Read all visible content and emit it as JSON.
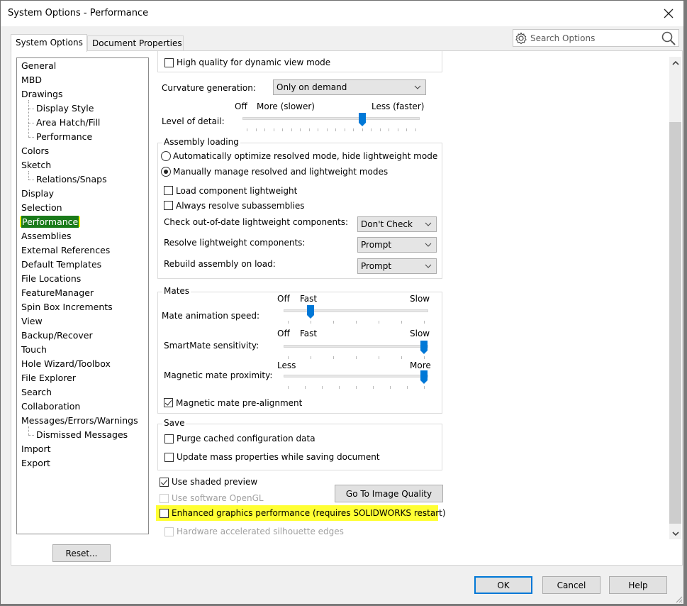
{
  "window": {
    "title": "System Options - Performance",
    "close_label": "Close"
  },
  "tabs": [
    {
      "label": "System Options",
      "active": true
    },
    {
      "label": "Document Properties",
      "active": false
    }
  ],
  "search": {
    "placeholder": "Search Options",
    "value": ""
  },
  "tree": {
    "items": [
      {
        "label": "General",
        "level": 0
      },
      {
        "label": "MBD",
        "level": 0
      },
      {
        "label": "Drawings",
        "level": 0
      },
      {
        "label": "Display Style",
        "level": 1
      },
      {
        "label": "Area Hatch/Fill",
        "level": 1
      },
      {
        "label": "Performance",
        "level": 1
      },
      {
        "label": "Colors",
        "level": 0
      },
      {
        "label": "Sketch",
        "level": 0
      },
      {
        "label": "Relations/Snaps",
        "level": 1
      },
      {
        "label": "Display",
        "level": 0
      },
      {
        "label": "Selection",
        "level": 0
      },
      {
        "label": "Performance",
        "level": 0,
        "selected": true
      },
      {
        "label": "Assemblies",
        "level": 0
      },
      {
        "label": "External References",
        "level": 0
      },
      {
        "label": "Default Templates",
        "level": 0
      },
      {
        "label": "File Locations",
        "level": 0
      },
      {
        "label": "FeatureManager",
        "level": 0
      },
      {
        "label": "Spin Box Increments",
        "level": 0
      },
      {
        "label": "View",
        "level": 0
      },
      {
        "label": "Backup/Recover",
        "level": 0
      },
      {
        "label": "Touch",
        "level": 0
      },
      {
        "label": "Hole Wizard/Toolbox",
        "level": 0
      },
      {
        "label": "File Explorer",
        "level": 0
      },
      {
        "label": "Search",
        "level": 0
      },
      {
        "label": "Collaboration",
        "level": 0
      },
      {
        "label": "Messages/Errors/Warnings",
        "level": 0
      },
      {
        "label": "Dismissed Messages",
        "level": 1
      },
      {
        "label": "Import",
        "level": 0
      },
      {
        "label": "Export",
        "level": 0
      }
    ],
    "reset_label": "Reset..."
  },
  "options": {
    "high_quality_dynamic": {
      "label": "High quality for dynamic view mode",
      "checked": false
    },
    "curvature": {
      "label": "Curvature generation:",
      "value": "Only on demand"
    },
    "level_of_detail": {
      "label": "Level of detail:",
      "label_off": "Off",
      "label_more": "More (slower)",
      "label_less": "Less (faster)",
      "ticks": 20,
      "value": 13
    },
    "assembly_loading": {
      "title": "Assembly loading",
      "radio_auto": {
        "label": "Automatically optimize resolved mode, hide lightweight mode",
        "checked": false
      },
      "radio_manual": {
        "label": "Manually manage resolved and lightweight modes",
        "checked": true
      },
      "load_lightweight": {
        "label": "Load component lightweight",
        "checked": false
      },
      "always_resolve": {
        "label": "Always resolve subassemblies",
        "checked": false
      },
      "check_outdated": {
        "label": "Check out-of-date lightweight components:",
        "value": "Don't Check"
      },
      "resolve_lightweight": {
        "label": "Resolve lightweight components:",
        "value": "Prompt"
      },
      "rebuild_on_load": {
        "label": "Rebuild assembly on load:",
        "value": "Prompt"
      }
    },
    "mates": {
      "title": "Mates",
      "animation_speed": {
        "label": "Mate animation speed:",
        "label_off": "Off",
        "label_fast": "Fast",
        "label_slow": "Slow",
        "ticks": 7,
        "value": 1
      },
      "smartmate": {
        "label": "SmartMate sensitivity:",
        "label_off": "Off",
        "label_fast": "Fast",
        "label_slow": "Slow",
        "ticks": 7,
        "value": 6
      },
      "magnetic_proximity": {
        "label": "Magnetic mate proximity:",
        "label_less": "Less",
        "label_more": "More",
        "ticks": 9,
        "value": 8
      },
      "pre_alignment": {
        "label": "Magnetic mate pre-alignment",
        "checked": true
      }
    },
    "save": {
      "title": "Save",
      "purge_cached": {
        "label": "Purge cached configuration data",
        "checked": false
      },
      "update_mass": {
        "label": "Update mass properties while saving document",
        "checked": false
      }
    },
    "use_shaded_preview": {
      "label": "Use shaded preview",
      "checked": true
    },
    "use_software_opengl": {
      "label": "Use software OpenGL",
      "checked": false,
      "disabled": true
    },
    "go_to_image_quality": "Go To Image Quality",
    "enhanced_graphics": {
      "label": "Enhanced graphics performance (requires SOLIDWORKS restart)",
      "checked": false,
      "highlighted": true
    },
    "hw_silhouette": {
      "label": "Hardware accelerated silhouette edges",
      "checked": false,
      "disabled": true
    }
  },
  "footer": {
    "ok": "OK",
    "cancel": "Cancel",
    "help": "Help"
  },
  "colors": {
    "accent": "#0078d7",
    "highlight": "#ffff00",
    "selection": "#1a7a1a"
  }
}
